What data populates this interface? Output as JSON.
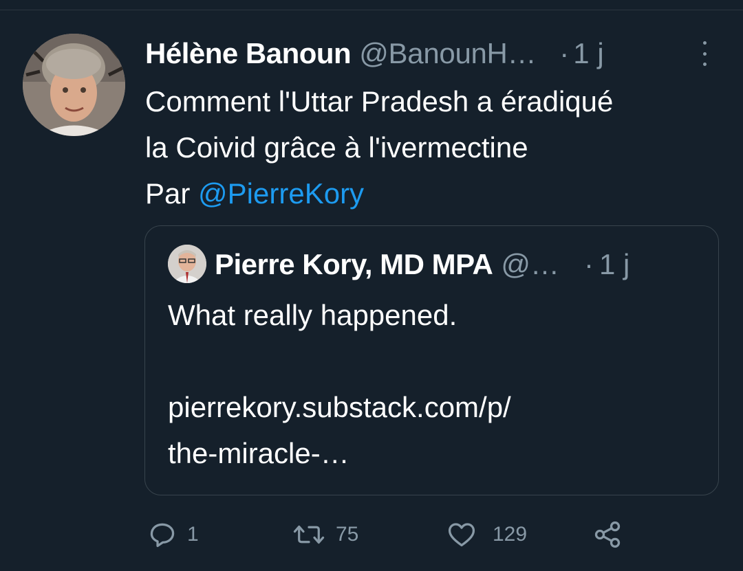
{
  "tweet": {
    "author_name": "Hélène Banoun",
    "author_handle": "@BanounH…",
    "separator": "·",
    "time": "1 j",
    "text_lines": [
      "Comment l'Uttar Pradesh a éradiqué",
      "la Coivid grâce à l'ivermectine"
    ],
    "by_prefix": "Par ",
    "mention": "@PierreKory"
  },
  "quote": {
    "author_name": "Pierre Kory, MD MPA",
    "author_handle": "@…",
    "separator": "·",
    "time": "1 j",
    "text_lines": [
      "What really happened.",
      "",
      "pierrekory.substack.com/p/",
      "the-miracle-…"
    ]
  },
  "actions": {
    "reply_count": "1",
    "retweet_count": "75",
    "like_count": "129"
  },
  "colors": {
    "background": "#15202b",
    "secondary_text": "#8899a6",
    "link": "#1d9bf0",
    "border": "#38444d"
  },
  "icons": {
    "more": "more-vertical-icon",
    "reply": "reply-icon",
    "retweet": "retweet-icon",
    "like": "heart-icon",
    "share": "share-icon"
  }
}
